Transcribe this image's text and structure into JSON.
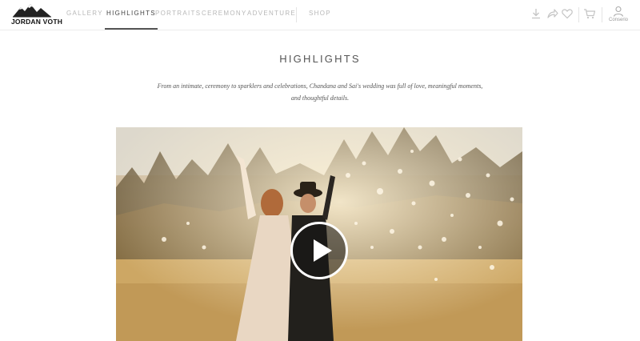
{
  "brand": {
    "logo_text": "JORDAN VOTH"
  },
  "nav": {
    "items": [
      {
        "label": "GALLERY",
        "active": false
      },
      {
        "label": "HIGHLIGHTS",
        "active": true
      },
      {
        "label": "PORTRAITS",
        "active": false
      },
      {
        "label": "CEREMONY",
        "active": false
      },
      {
        "label": "ADVENTURE",
        "active": false
      },
      {
        "label": "SHOP",
        "active": false
      }
    ]
  },
  "toolbar": {
    "icons": [
      "download-icon",
      "share-icon",
      "heart-icon",
      "cart-icon",
      "user-icon"
    ],
    "account_label": "Conserio"
  },
  "main": {
    "title": "HIGHLIGHTS",
    "description": "From an intimate, ceremony to sparklers and celebrations, Chandana and Sai's wedding was full of love, meaningful moments, and thoughtful details."
  },
  "colors": {
    "active_nav": "#444444",
    "inactive_nav": "#b8b8b8",
    "play_overlay": "#141414"
  }
}
